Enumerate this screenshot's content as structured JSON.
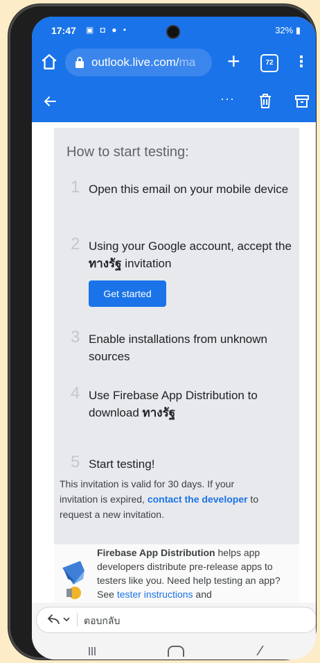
{
  "status": {
    "time": "17:47",
    "notif_icons": "▣ ◘ ● •",
    "right": "⏰ 📶 32%",
    "battery": "32%"
  },
  "browser": {
    "url_main": "outlook.live.com/",
    "url_fade": "ma",
    "tab_count": "72"
  },
  "mail_toolbar": {
    "more_label": "···"
  },
  "email": {
    "heading": "How to start testing:",
    "steps": [
      {
        "num": "1",
        "text": "Open this email on your mobile device"
      },
      {
        "num": "2",
        "text_before": "Using your Google account, accept the ",
        "app_name": "ทางรัฐ",
        "text_after": " invitation"
      },
      {
        "num": "3",
        "text": "Enable installations from unknown sources"
      },
      {
        "num": "4",
        "text_before": "Use Firebase App Distribution to download ",
        "app_name": "ทางรัฐ"
      },
      {
        "num": "5",
        "text": "Start testing!"
      }
    ],
    "get_started_label": "Get started",
    "validity_before": "This invitation is valid for 30 days. If your invitation is expired, ",
    "validity_link": "contact the developer",
    "validity_after": " to request a new invitation.",
    "footer_bold": "Firebase App Distribution",
    "footer_text": " helps app developers distribute pre-release apps to testers like you. Need help testing an app? See ",
    "footer_link": "tester instructions",
    "footer_after": " and"
  },
  "reply": {
    "label": "ตอบกลับ"
  },
  "colors": {
    "accent": "#1a73e8",
    "background": "#fcecc8"
  }
}
